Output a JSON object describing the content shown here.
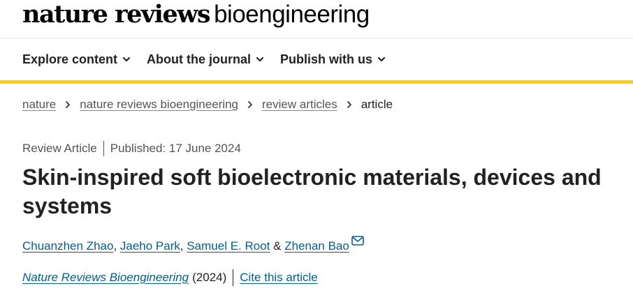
{
  "header": {
    "brand": "nature reviews",
    "journal": "bioengineering"
  },
  "nav": {
    "items": [
      {
        "label": "Explore content",
        "icon": "chevron-down-icon"
      },
      {
        "label": "About the journal",
        "icon": "chevron-down-icon"
      },
      {
        "label": "Publish with us",
        "icon": "chevron-down-icon"
      }
    ]
  },
  "breadcrumb": {
    "items": [
      {
        "label": "nature"
      },
      {
        "label": "nature reviews bioengineering"
      },
      {
        "label": "review articles"
      }
    ],
    "current": "article"
  },
  "article": {
    "type": "Review Article",
    "published": "Published: 17 June 2024",
    "title": "Skin-inspired soft bioelectronic materials, devices and systems",
    "authors": [
      {
        "name": "Chuanzhen Zhao",
        "after": ", "
      },
      {
        "name": "Jaeho Park",
        "after": ", "
      },
      {
        "name": "Samuel E. Root",
        "after": " & "
      },
      {
        "name": "Zhenan Bao",
        "after": ""
      }
    ],
    "citation": {
      "journal": "Nature Reviews Bioengineering",
      "year": "(2024)",
      "cite_label": "Cite this article"
    }
  },
  "colors": {
    "accent": "#ffcc00",
    "link": "#025e8d",
    "text": "#222222",
    "muted": "#555555"
  }
}
